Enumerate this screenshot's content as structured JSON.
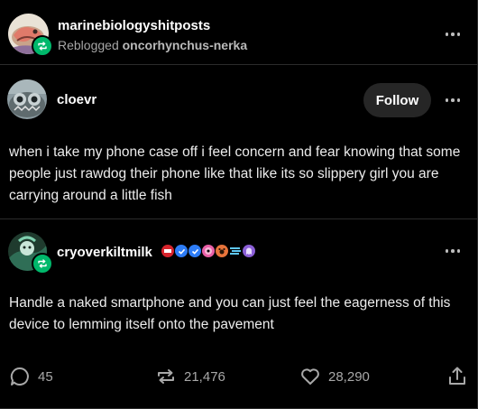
{
  "reblog_header": {
    "blog_name": "marinebiologyshitposts",
    "reblogged_prefix": "Reblogged",
    "reblogged_from": "oncorhynchus-nerka"
  },
  "posts": [
    {
      "username": "cloevr",
      "follow_label": "Follow",
      "text": "when i take my phone case off i feel concern and fear knowing that some people just rawdog their phone like that like its so slippery girl you are carrying around a little fish"
    },
    {
      "username": "cryoverkiltmilk",
      "text": "Handle a naked smartphone and you can just feel the eagerness of this device to lemming itself onto the pavement"
    }
  ],
  "actions": {
    "replies": "45",
    "reblogs": "21,476",
    "likes": "28,290"
  },
  "colors": {
    "reblog_green": "#00b86b",
    "verified_blue": "#2d7cf6",
    "follow_bg": "#262626"
  },
  "icons": [
    "reblog-icon",
    "more-options-icon",
    "reply-icon",
    "reblog-count-icon",
    "heart-icon",
    "share-icon",
    "verified-badge-icon"
  ]
}
